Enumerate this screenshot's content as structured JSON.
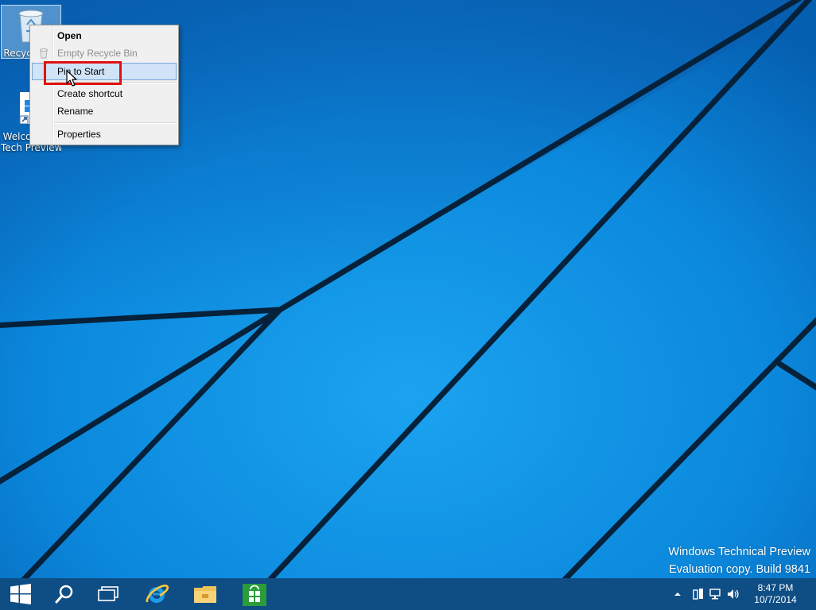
{
  "desktop": {
    "icons": [
      {
        "label": "Recycle Bin",
        "icon": "recycle-bin-icon"
      },
      {
        "label_line1": "Welcome to",
        "label_line2": "Tech Preview",
        "icon": "windows-welcome-icon"
      }
    ]
  },
  "context_menu": {
    "items": [
      {
        "label": "Open",
        "style": "bold"
      },
      {
        "label": "Empty Recycle Bin",
        "style": "disabled",
        "icon": "recycle-bin-small-icon"
      },
      {
        "label": "Pin to Start",
        "style": "hover"
      },
      {
        "label": "Create shortcut"
      },
      {
        "label": "Rename"
      },
      {
        "label": "Properties"
      }
    ],
    "highlighted_item": "Pin to Start",
    "highlight_color": "#e01010"
  },
  "watermark": {
    "line1": "Windows Technical Preview",
    "line2": "Evaluation copy. Build 9841"
  },
  "taskbar": {
    "buttons": [
      {
        "name": "start",
        "icon": "windows-logo-icon"
      },
      {
        "name": "search",
        "icon": "search-icon"
      },
      {
        "name": "task-view",
        "icon": "task-view-icon"
      },
      {
        "name": "internet-explorer",
        "icon": "internet-explorer-icon"
      },
      {
        "name": "file-explorer",
        "icon": "folder-icon"
      },
      {
        "name": "store",
        "icon": "store-icon"
      }
    ],
    "tray": {
      "icons": [
        "show-hidden-icons-chevron",
        "action-center-icon",
        "network-icon",
        "volume-icon"
      ],
      "time": "8:47 PM",
      "date": "10/7/2014"
    },
    "color": "#0f4d85"
  },
  "colors": {
    "wallpaper_blue": "#0a7fd6",
    "menu_hover": "#d1e3f7"
  }
}
